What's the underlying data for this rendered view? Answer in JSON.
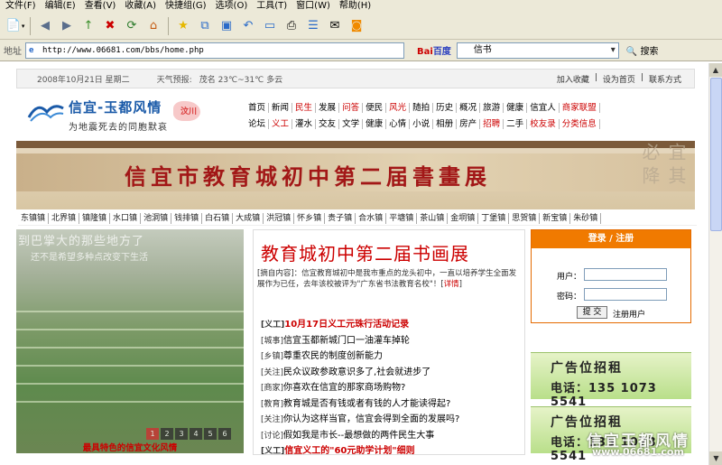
{
  "menu": [
    "文件(F)",
    "编辑(E)",
    "查看(V)",
    "收藏(A)",
    "快捷组(G)",
    "选项(O)",
    "工具(T)",
    "窗口(W)",
    "帮助(H)"
  ],
  "address": {
    "label": "地址",
    "url": "http://www.06681.com/bbs/home.php"
  },
  "search": {
    "engine_a": "Bai",
    "engine_b": "百度",
    "query": "信书",
    "button": "搜索"
  },
  "topbar": {
    "date": "2008年10月21日 星期二",
    "weather_label": "天气预报:",
    "weather": "茂名 23℃~31℃ 多云",
    "links": [
      "加入收藏",
      "设为首页",
      "联系方式"
    ]
  },
  "logo": {
    "title": "信宜-玉都风情",
    "subtitle": "为地震死去的同胞默哀",
    "tag": "汶川"
  },
  "nav_row1": [
    "首页",
    "新闻",
    "民生",
    "发展",
    "问答",
    "便民",
    "风光",
    "随拍",
    "历史",
    "概况",
    "旅游",
    "健康",
    "信宜人",
    "商家联盟"
  ],
  "nav_row2": [
    "论坛",
    "义工",
    "灌水",
    "交友",
    "文学",
    "健康",
    "心情",
    "小说",
    "相册",
    "房产",
    "招聘",
    "二手",
    "校友录",
    "分类信息"
  ],
  "banner": {
    "title": "信宜市教育城初中第二届書畫展"
  },
  "towns": [
    "东镇镇",
    "北界镇",
    "镇隆镇",
    "水口镇",
    "池洞镇",
    "钱排镇",
    "白石镇",
    "大成镇",
    "洪冠镇",
    "怀乡镇",
    "贵子镇",
    "合水镇",
    "平塘镇",
    "茶山镇",
    "金垌镇",
    "丁堡镇",
    "思贺镇",
    "新宝镇",
    "朱砂镇"
  ],
  "photo": {
    "overlay1": "到巴掌大的那些地方了",
    "overlay2": "还不是希望多种点改变下生活",
    "caption": "最具特色的信宜文化风情",
    "pages": [
      "1",
      "2",
      "3",
      "4",
      "5",
      "6"
    ]
  },
  "article": {
    "title": "教育城初中第二届书画展",
    "summary": "[摘自内容]：信宜教育城初中是我市重点的龙头初中，一直以培养学生全面发展作为已任，去年该校被评为\"广东省书法教育名校\"！[",
    "more": "详情",
    "summary_end": "]"
  },
  "news": [
    {
      "tag": "[义工]",
      "text": "10月17日义工元珠行活动记录",
      "hot": true
    },
    {
      "tag": "[城事]",
      "text": "信宜玉都新城门口一油灌车掉轮",
      "hot": false
    },
    {
      "tag": "[乡镇]",
      "text": "尊重农民的制度创新能力",
      "hot": false
    },
    {
      "tag": "[关注]",
      "text": "民众议政参政意识多了,社会就进步了",
      "hot": false
    },
    {
      "tag": "[商家]",
      "text": "你喜欢在信宜的那家商场购物?",
      "hot": false
    },
    {
      "tag": "[教育]",
      "text": "教育城是否有钱或者有钱的人才能读得起?",
      "hot": false
    },
    {
      "tag": "[关注]",
      "text": "你认为这样当官，信宜会得到全面的发展吗?",
      "hot": false
    },
    {
      "tag": "[讨论]",
      "text": "假如我是市长--最想做的两件民生大事",
      "hot": false
    },
    {
      "tag": "[义工]",
      "text": "信宜义工的\"60元助学计划\"细则",
      "hot": true
    }
  ],
  "login": {
    "header": "登录 / 注册",
    "user_label": "用户：",
    "pass_label": "密码：",
    "submit": "提 交",
    "register": "注册用户"
  },
  "ads": [
    {
      "line1": "广告位招租",
      "line2": "电话：135 1073 5541"
    },
    {
      "line1": "广告位招租",
      "line2": "电话：135 1073 5541"
    }
  ],
  "watermark": {
    "line1": "信宜玉都风情",
    "line2": "www.06681.com"
  }
}
